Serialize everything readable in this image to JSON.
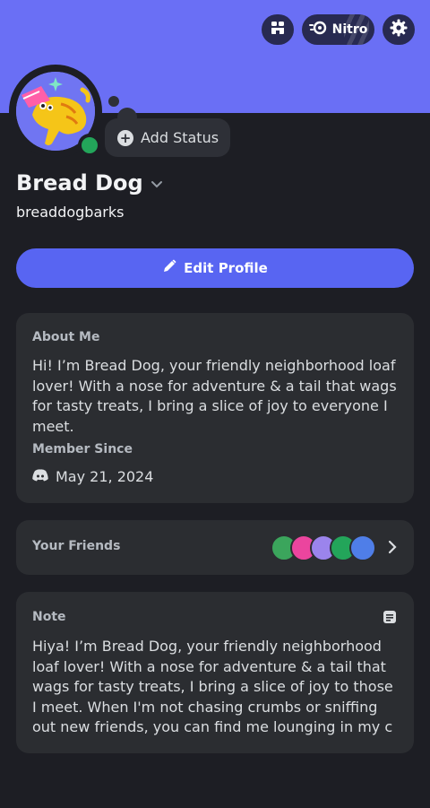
{
  "header": {
    "nitro_label": "Nitro"
  },
  "status": {
    "add_status_label": "Add Status",
    "online_color": "#23a55a"
  },
  "profile": {
    "display_name": "Bread Dog",
    "username": "breaddogbarks",
    "edit_label": "Edit Profile"
  },
  "about": {
    "heading": "About Me",
    "text": "Hi! I’m Bread Dog, your friendly neighborhood loaf lover! With a nose for adventure & a tail that wags for tasty treats, I bring a slice of joy to everyone I meet.",
    "member_since_heading": "Member Since",
    "member_since_date": "May 21, 2024"
  },
  "friends": {
    "heading": "Your Friends",
    "avatar_colors": [
      "#3ba55c",
      "#eb459e",
      "#9b84ec",
      "#23a55a",
      "#4f7ee8"
    ]
  },
  "note": {
    "heading": "Note",
    "text": "Hiya! I’m Bread Dog, your friendly neighborhood loaf lover! With a nose for adventure & a tail that wags for tasty treats, I bring a slice of joy to those I meet. When I'm not chasing crumbs or sniffing out new friends,  you can find me lounging in my c"
  },
  "colors": {
    "banner": "#6a6ff5",
    "accent": "#5865f2",
    "background": "#1d1e24",
    "card": "#2b2d31"
  }
}
